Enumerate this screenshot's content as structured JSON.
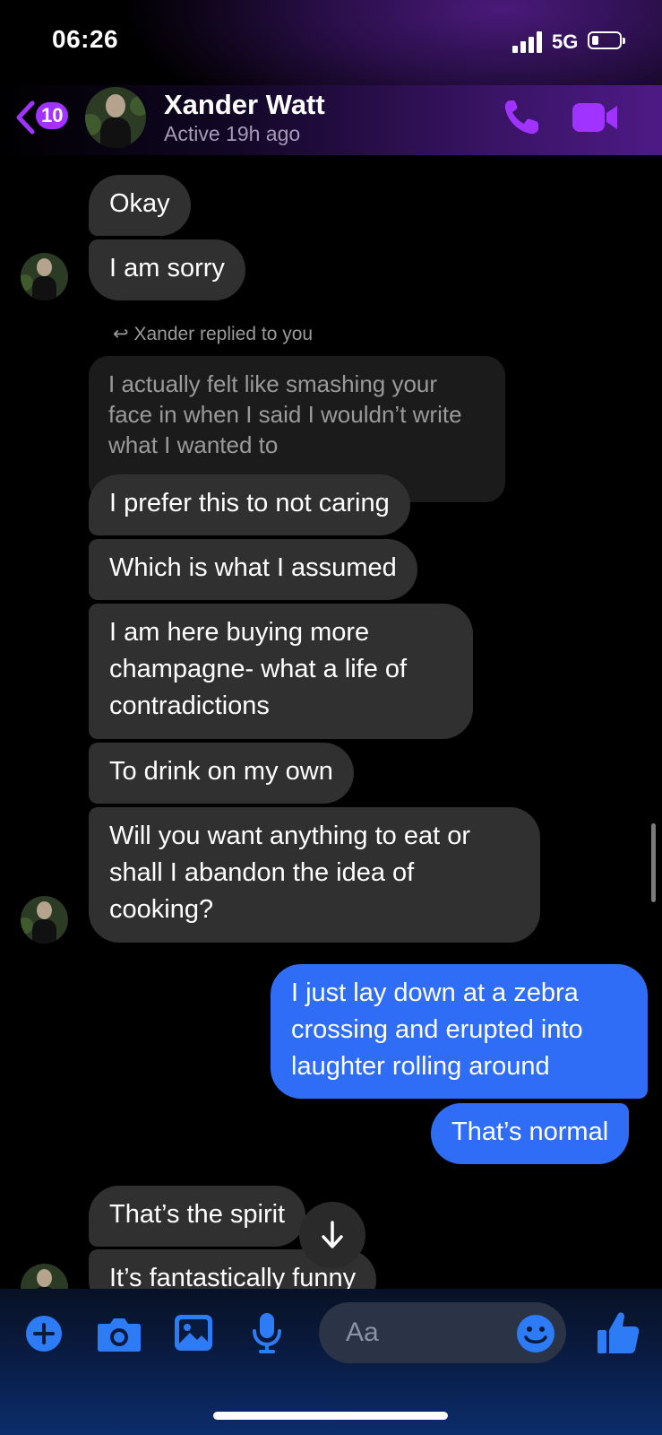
{
  "status_bar": {
    "time": "06:26",
    "network": "5G"
  },
  "header": {
    "unread_count": "10",
    "contact_name": "Xander Watt",
    "activity": "Active 19h ago"
  },
  "messages": [
    {
      "from": "them",
      "text": "Okay"
    },
    {
      "from": "them",
      "text": "I am sorry"
    },
    {
      "from": "them",
      "reply_label": "Xander replied to you",
      "quoted_text": "I actually felt like smashing your face in when I said I wouldn’t write what I wanted to",
      "text": "I prefer this to not caring"
    },
    {
      "from": "them",
      "text": "Which is what I assumed"
    },
    {
      "from": "them",
      "text": "I am here buying more champagne- what a life of contradictions"
    },
    {
      "from": "them",
      "text": "To drink on my own"
    },
    {
      "from": "them",
      "text": "Will you want anything to eat or shall I abandon the idea of cooking?"
    },
    {
      "from": "me",
      "text": "I just lay down at a zebra crossing and erupted into laughter rolling around"
    },
    {
      "from": "me",
      "text": "That’s normal"
    },
    {
      "from": "them",
      "text": "That’s the spirit"
    },
    {
      "from": "them",
      "text": "It’s fantastically funny"
    }
  ],
  "composer": {
    "placeholder": "Aa"
  },
  "icons": {
    "back": "chevron-left-icon",
    "call": "phone-icon",
    "video": "video-camera-icon",
    "plus": "plus-circle-icon",
    "camera": "camera-icon",
    "gallery": "image-icon",
    "mic": "microphone-icon",
    "emoji": "emoji-icon",
    "like": "thumbs-up-icon",
    "scroll_down": "arrow-down-icon"
  },
  "colors": {
    "accent_purple": "#a033ff",
    "sent_bubble": "#2f6df6",
    "received_bubble": "#303030",
    "composer_icons": "#2d7cf6"
  }
}
